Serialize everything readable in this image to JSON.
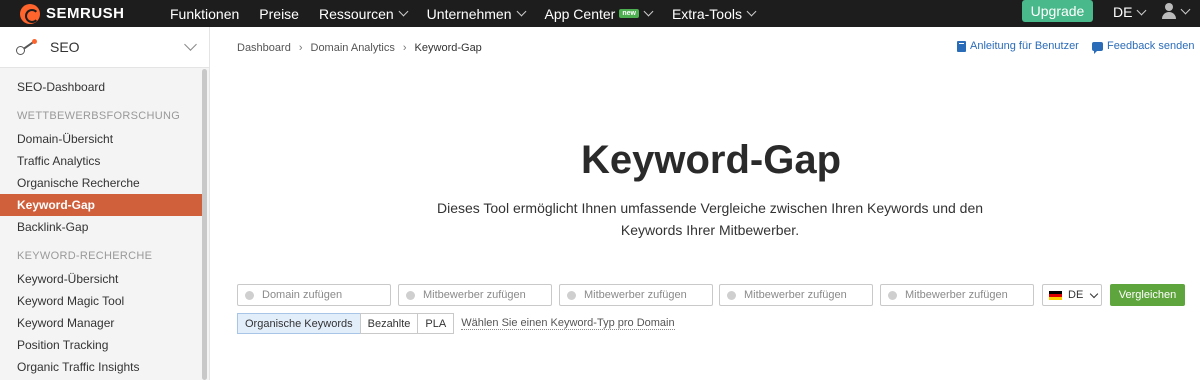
{
  "topbar": {
    "brand": "SEMRUSH",
    "nav": [
      {
        "label": "Funktionen",
        "dropdown": false
      },
      {
        "label": "Preise",
        "dropdown": false
      },
      {
        "label": "Ressourcen",
        "dropdown": true
      },
      {
        "label": "Unternehmen",
        "dropdown": true
      },
      {
        "label": "App Center",
        "dropdown": true,
        "badge": "new"
      },
      {
        "label": "Extra-Tools",
        "dropdown": true
      }
    ],
    "upgrade_label": "Upgrade",
    "language": "DE",
    "user_icon": "user-icon"
  },
  "sidebar": {
    "title": "SEO",
    "icon": "seo-icon",
    "items": [
      {
        "type": "item",
        "label": "SEO-Dashboard"
      },
      {
        "type": "section",
        "label": "WETTBEWERBSFORSCHUNG"
      },
      {
        "type": "item",
        "label": "Domain-Übersicht"
      },
      {
        "type": "item",
        "label": "Traffic Analytics"
      },
      {
        "type": "item",
        "label": "Organische Recherche"
      },
      {
        "type": "item",
        "label": "Keyword-Gap",
        "active": true
      },
      {
        "type": "item",
        "label": "Backlink-Gap"
      },
      {
        "type": "section",
        "label": "KEYWORD-RECHERCHE"
      },
      {
        "type": "item",
        "label": "Keyword-Übersicht"
      },
      {
        "type": "item",
        "label": "Keyword Magic Tool"
      },
      {
        "type": "item",
        "label": "Keyword Manager"
      },
      {
        "type": "item",
        "label": "Position Tracking"
      },
      {
        "type": "item",
        "label": "Organic Traffic Insights"
      }
    ]
  },
  "breadcrumb": [
    "Dashboard",
    "Domain Analytics",
    "Keyword-Gap"
  ],
  "help_links": {
    "guide": "Anleitung für Benutzer",
    "feedback": "Feedback senden"
  },
  "main": {
    "title": "Keyword-Gap",
    "description": "Dieses Tool ermöglicht Ihnen umfassende Vergleiche zwischen Ihren Keywords und den Keywords Ihrer Mitbewerber.",
    "fields": [
      {
        "placeholder": "Domain zufügen"
      },
      {
        "placeholder": "Mitbewerber zufügen"
      },
      {
        "placeholder": "Mitbewerber zufügen"
      },
      {
        "placeholder": "Mitbewerber zufügen"
      },
      {
        "placeholder": "Mitbewerber zufügen"
      }
    ],
    "database": "DE",
    "compare_label": "Vergleichen",
    "keyword_types": [
      {
        "label": "Organische Keywords",
        "selected": true
      },
      {
        "label": "Bezahlte",
        "selected": false
      },
      {
        "label": "PLA",
        "selected": false
      }
    ],
    "keyword_type_hint": "Wählen Sie einen Keyword-Typ pro Domain"
  },
  "colors": {
    "topbar_bg": "#1d1d1d",
    "brand_orange": "#ff642d",
    "upgrade_green": "#49b88a",
    "active_item": "#d05f3b",
    "compare_green": "#5fa53e",
    "link_blue": "#2b6cb8"
  }
}
